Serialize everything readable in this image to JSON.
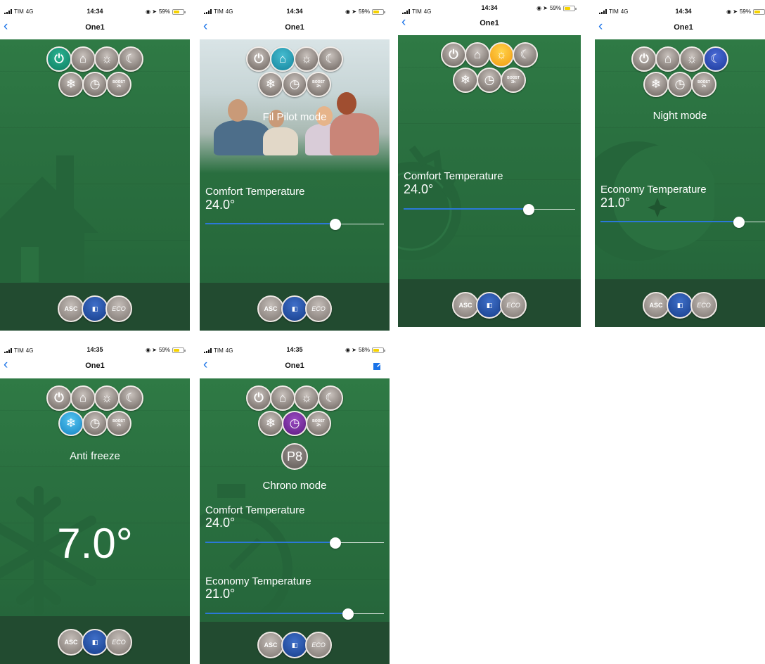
{
  "status": {
    "carrier": "TIM",
    "network": "4G"
  },
  "icons": {
    "power": "power-icon",
    "home": "home-icon",
    "comfort": "sun-icon",
    "night": "moon-icon",
    "antifreeze": "snowflake-icon",
    "chrono": "clock-icon",
    "boost": "boost-icon",
    "asc": "asc-icon",
    "window": "open-window-icon",
    "eco": "eco-leaf-icon"
  },
  "colors": {
    "background_green": "#2a7040",
    "footer_green": "#224b30",
    "slider_blue": "#2b78d8",
    "link_blue": "#1a73e8",
    "battery_yellow": "#f6d200"
  },
  "boost_label": "BOOST",
  "boost_sub": "2h",
  "footer": {
    "asc": "ASC",
    "eco": "ECO"
  },
  "screens": [
    {
      "time": "14:34",
      "battery": "59%",
      "title": "One1",
      "active_mode": "power"
    },
    {
      "time": "14:34",
      "battery": "59%",
      "title": "One1",
      "active_mode": "home",
      "mode_label": "Fil Pilot mode",
      "temp_label": "Comfort Temperature",
      "temp_value": "24.0°",
      "slider_level": 0.73
    },
    {
      "time": "14:34",
      "battery": "59%",
      "title": "One1",
      "active_mode": "comfort",
      "temp_label": "Comfort Temperature",
      "temp_value": "24.0°",
      "slider_level": 0.73
    },
    {
      "time": "14:34",
      "battery": "59%",
      "title": "One1",
      "active_mode": "night",
      "mode_label": "Night mode",
      "temp_label": "Economy Temperature",
      "temp_value": "21.0°",
      "slider_level": 0.8
    },
    {
      "time": "14:35",
      "battery": "59%",
      "title": "One1",
      "active_mode": "antifreeze",
      "mode_label": "Anti freeze",
      "big_temp": "7.0°"
    },
    {
      "time": "14:35",
      "battery": "58%",
      "title": "One1",
      "active_mode": "chrono",
      "program": "P8",
      "mode_label": "Chrono mode",
      "comfort_label": "Comfort Temperature",
      "comfort_value": "24.0°",
      "comfort_level": 0.73,
      "economy_label": "Economy Temperature",
      "economy_value": "21.0°",
      "economy_level": 0.8
    }
  ]
}
